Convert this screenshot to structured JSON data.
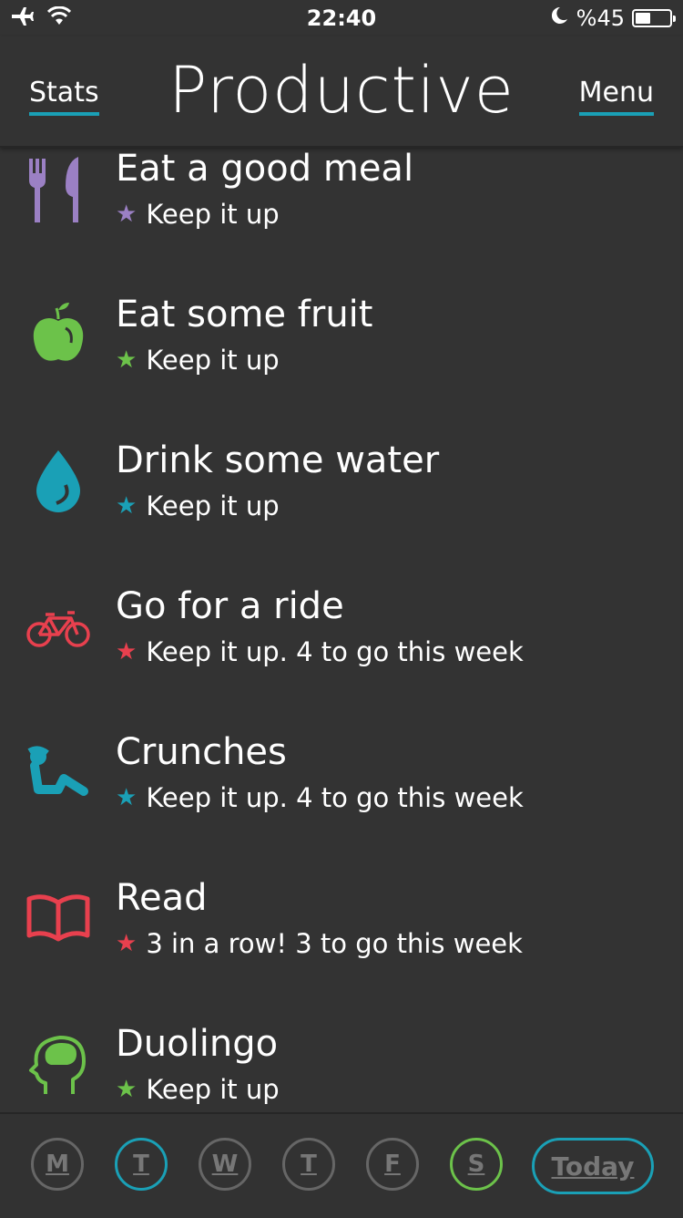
{
  "status_bar": {
    "time": "22:40",
    "battery_text": "%45",
    "battery_level": 0.45
  },
  "header": {
    "title": "Productive",
    "left_button": "Stats",
    "right_button": "Menu",
    "accent": "#1aa0b6"
  },
  "habits": [
    {
      "name": "Eat a good meal",
      "status": "Keep it up",
      "color": "#9b80c4",
      "icon": "fork-knife-icon"
    },
    {
      "name": "Eat some fruit",
      "status": "Keep it up",
      "color": "#6cc24a",
      "icon": "apple-icon"
    },
    {
      "name": "Drink some water",
      "status": "Keep it up",
      "color": "#1aa0b6",
      "icon": "water-drop-icon"
    },
    {
      "name": "Go for a ride",
      "status": "Keep it up. 4 to go this week",
      "color": "#e8404e",
      "icon": "bicycle-icon"
    },
    {
      "name": "Crunches",
      "status": "Keep it up. 4 to go this week",
      "color": "#1aa0b6",
      "icon": "crunches-icon"
    },
    {
      "name": "Read",
      "status": "3 in a row! 3 to go this week",
      "color": "#e8404e",
      "icon": "book-icon"
    },
    {
      "name": "Duolingo",
      "status": "Keep it up",
      "color": "#6cc24a",
      "icon": "brain-head-icon"
    }
  ],
  "days": [
    {
      "label": "M",
      "ring": "#666666"
    },
    {
      "label": "T",
      "ring": "#1aa0b6"
    },
    {
      "label": "W",
      "ring": "#666666"
    },
    {
      "label": "T",
      "ring": "#666666"
    },
    {
      "label": "F",
      "ring": "#666666"
    },
    {
      "label": "S",
      "ring": "#6cc24a"
    }
  ],
  "today_label": "Today"
}
